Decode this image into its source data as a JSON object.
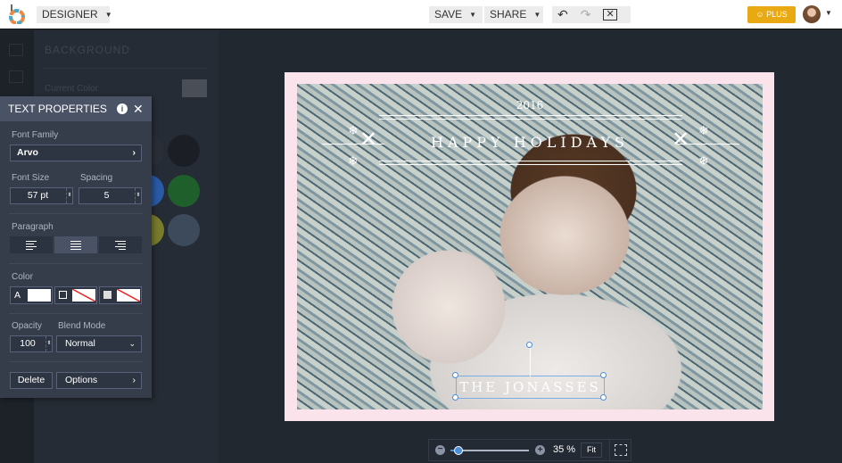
{
  "topbar": {
    "mode_label": "DESIGNER",
    "save_label": "SAVE",
    "share_label": "SHARE",
    "plus_label": "PLUS",
    "icons": [
      "undo-icon",
      "redo-icon",
      "close-square-icon"
    ]
  },
  "background_panel": {
    "title": "BACKGROUND",
    "current_color_label": "Current Color",
    "swatches": [
      "#2a2f37",
      "#1b1f25",
      "#2a5aa6",
      "#1f5f2b",
      "#7a7c2c",
      "#3c4a5c"
    ]
  },
  "text_properties": {
    "title": "TEXT PROPERTIES",
    "font_family_label": "Font Family",
    "font_family": "Arvo",
    "font_size_label": "Font Size",
    "font_size": "57 pt",
    "spacing_label": "Spacing",
    "spacing": "5",
    "paragraph_label": "Paragraph",
    "alignment": "center",
    "color_label": "Color",
    "text_color_glyph": "A",
    "opacity_label": "Opacity",
    "opacity": "100",
    "blend_label": "Blend Mode",
    "blend": "Normal",
    "delete_label": "Delete",
    "options_label": "Options"
  },
  "canvas": {
    "year": "2016",
    "headline": "HAPPY HOLIDAYS",
    "name": "THE JONASSES",
    "border_color": "#fbe3ec"
  },
  "zoom": {
    "value": "35 %",
    "fit_label": "Fit",
    "level": 0.1
  }
}
